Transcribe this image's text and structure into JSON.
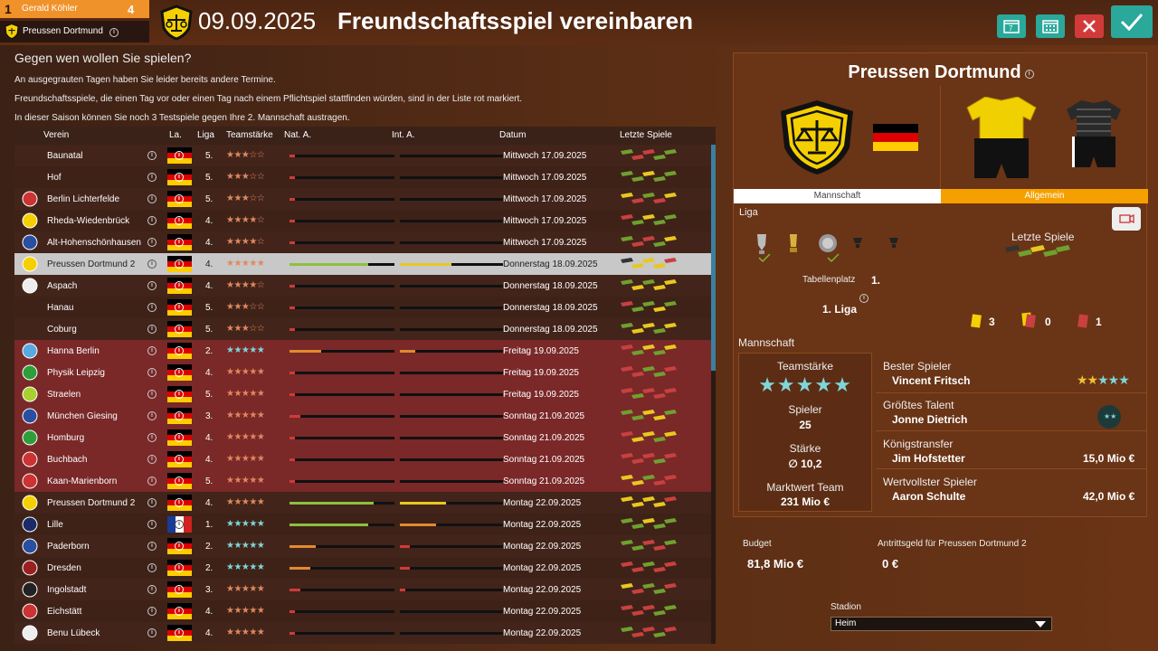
{
  "header": {
    "rank": "1",
    "manager": "Gerald Köhler",
    "manager_count": "4",
    "club": "Preussen Dortmund",
    "date": "09.09.2025",
    "title": "Freundschaftsspiel vereinbaren",
    "buttons": [
      {
        "name": "calendar-7-button",
        "icon": "calendar-7-icon",
        "color": "#2aa89a"
      },
      {
        "name": "calendar-button",
        "icon": "calendar-icon",
        "color": "#2aa89a"
      },
      {
        "name": "cancel-button",
        "icon": "close-icon",
        "color": "#d23a3a"
      },
      {
        "name": "confirm-button",
        "icon": "check-icon",
        "color": "#2aa89a"
      }
    ]
  },
  "main": {
    "question": "Gegen wen wollen Sie spielen?",
    "notes": [
      "An ausgegrauten Tagen haben Sie leider bereits andere Termine.",
      "Freundschaftsspiele, die einen Tag vor oder einen Tag nach einem Pflichtspiel stattfinden würden, sind in der Liste rot markiert.",
      "In dieser Saison können Sie noch 3 Testspiele gegen Ihre 2. Mannschaft austragen."
    ]
  },
  "columns": {
    "club": "Verein",
    "country": "La.",
    "league": "Liga",
    "strength": "Teamstärke",
    "nat": "Nat. A.",
    "intl": "Int. A.",
    "date": "Datum",
    "last": "Letzte Spiele"
  },
  "rows": [
    {
      "club": "Baunatal",
      "league": "5.",
      "stars": "★★★☆☆",
      "nat": 0.05,
      "intl": 0,
      "date": "Mittwoch 17.09.2025",
      "red": false,
      "sel": false,
      "flag": "de",
      "logo": "none",
      "last": [
        "g",
        "r",
        "r",
        "g",
        "g"
      ]
    },
    {
      "club": "Hof",
      "league": "5.",
      "stars": "★★★☆☆",
      "nat": 0.05,
      "intl": 0,
      "date": "Mittwoch 17.09.2025",
      "red": false,
      "sel": false,
      "flag": "de",
      "logo": "none",
      "last": [
        "g",
        "g",
        "y",
        "g",
        "g"
      ]
    },
    {
      "club": "Berlin Lichterfelde",
      "league": "5.",
      "stars": "★★★☆☆",
      "nat": 0.05,
      "intl": 0,
      "date": "Mittwoch 17.09.2025",
      "red": false,
      "sel": false,
      "flag": "de",
      "logo": "red",
      "last": [
        "y",
        "r",
        "g",
        "r",
        "y"
      ]
    },
    {
      "club": "Rheda-Wiedenbrück",
      "league": "4.",
      "stars": "★★★★☆",
      "nat": 0.05,
      "intl": 0,
      "date": "Mittwoch 17.09.2025",
      "red": false,
      "sel": false,
      "flag": "de",
      "logo": "yellow",
      "last": [
        "r",
        "g",
        "y",
        "g",
        "g"
      ]
    },
    {
      "club": "Alt-Hohenschönhausen",
      "league": "4.",
      "stars": "★★★★☆",
      "nat": 0.05,
      "intl": 0,
      "date": "Mittwoch 17.09.2025",
      "red": false,
      "sel": false,
      "flag": "de",
      "logo": "blue",
      "last": [
        "g",
        "r",
        "r",
        "g",
        "y"
      ]
    },
    {
      "club": "Preussen Dortmund 2",
      "league": "4.",
      "stars": "★★★★★",
      "nat": 0.75,
      "intl": 0.5,
      "date": "Donnerstag 18.09.2025",
      "red": false,
      "sel": true,
      "flag": "de",
      "logo": "yellow",
      "last": [
        "d",
        "y",
        "y",
        "y",
        "r"
      ]
    },
    {
      "club": "Aspach",
      "league": "4.",
      "stars": "★★★★☆",
      "nat": 0.05,
      "intl": 0,
      "date": "Donnerstag 18.09.2025",
      "red": false,
      "sel": false,
      "flag": "de",
      "logo": "white",
      "last": [
        "g",
        "y",
        "g",
        "y",
        "y"
      ]
    },
    {
      "club": "Hanau",
      "league": "5.",
      "stars": "★★★☆☆",
      "nat": 0.05,
      "intl": 0,
      "date": "Donnerstag 18.09.2025",
      "red": false,
      "sel": false,
      "flag": "de",
      "logo": "none",
      "last": [
        "r",
        "g",
        "g",
        "y",
        "g"
      ]
    },
    {
      "club": "Coburg",
      "league": "5.",
      "stars": "★★★☆☆",
      "nat": 0.05,
      "intl": 0,
      "date": "Donnerstag 18.09.2025",
      "red": false,
      "sel": false,
      "flag": "de",
      "logo": "none",
      "last": [
        "g",
        "y",
        "y",
        "g",
        "y"
      ]
    },
    {
      "club": "Hanna Berlin",
      "league": "2.",
      "stars": "★★★★★",
      "nat": 0.3,
      "intl": 0.15,
      "date": "Freitag 19.09.2025",
      "red": true,
      "sel": false,
      "flag": "de",
      "logo": "lightblue",
      "last": [
        "r",
        "g",
        "y",
        "g",
        "y"
      ],
      "teal": true
    },
    {
      "club": "Physik Leipzig",
      "league": "4.",
      "stars": "★★★★★",
      "nat": 0,
      "intl": 0,
      "date": "Freitag 19.09.2025",
      "red": true,
      "sel": false,
      "flag": "de",
      "logo": "green",
      "last": [
        "r",
        "r",
        "g",
        "g",
        "r"
      ]
    },
    {
      "club": "Straelen",
      "league": "5.",
      "stars": "★★★★★",
      "nat": 0,
      "intl": 0,
      "date": "Freitag 19.09.2025",
      "red": true,
      "sel": false,
      "flag": "de",
      "logo": "greenyellow",
      "last": [
        "r",
        "g",
        "r",
        "r",
        "r"
      ]
    },
    {
      "club": "München Giesing",
      "league": "3.",
      "stars": "★★★★★",
      "nat": 0.1,
      "intl": 0,
      "date": "Sonntag 21.09.2025",
      "red": true,
      "sel": false,
      "flag": "de",
      "logo": "blue",
      "last": [
        "g",
        "g",
        "y",
        "y",
        "g"
      ]
    },
    {
      "club": "Homburg",
      "league": "4.",
      "stars": "★★★★★",
      "nat": 0,
      "intl": 0,
      "date": "Sonntag 21.09.2025",
      "red": true,
      "sel": false,
      "flag": "de",
      "logo": "green",
      "last": [
        "r",
        "y",
        "y",
        "g",
        "y"
      ]
    },
    {
      "club": "Buchbach",
      "league": "4.",
      "stars": "★★★★★",
      "nat": 0,
      "intl": 0,
      "date": "Sonntag 21.09.2025",
      "red": true,
      "sel": false,
      "flag": "de",
      "logo": "red",
      "last": [
        "r",
        "r",
        "r",
        "g",
        "r"
      ]
    },
    {
      "club": "Kaan-Marienborn",
      "league": "5.",
      "stars": "★★★★★",
      "nat": 0,
      "intl": 0,
      "date": "Sonntag 21.09.2025",
      "red": true,
      "sel": false,
      "flag": "de",
      "logo": "red",
      "last": [
        "y",
        "y",
        "g",
        "r",
        "r"
      ]
    },
    {
      "club": "Preussen Dortmund 2",
      "league": "4.",
      "stars": "★★★★★",
      "nat": 0.8,
      "intl": 0.45,
      "date": "Montag 22.09.2025",
      "red": false,
      "sel": false,
      "flag": "de",
      "logo": "yellow",
      "last": [
        "y",
        "y",
        "y",
        "y",
        "r"
      ]
    },
    {
      "club": "Lille",
      "league": "1.",
      "stars": "★★★★★",
      "nat": 0.75,
      "intl": 0.35,
      "date": "Montag 22.09.2025",
      "red": false,
      "sel": false,
      "flag": "fr",
      "logo": "navy",
      "last": [
        "g",
        "g",
        "y",
        "g",
        "g"
      ],
      "teal": true
    },
    {
      "club": "Paderborn",
      "league": "2.",
      "stars": "★★★★★",
      "nat": 0.25,
      "intl": 0.1,
      "date": "Montag 22.09.2025",
      "red": false,
      "sel": false,
      "flag": "de",
      "logo": "blue",
      "last": [
        "g",
        "g",
        "r",
        "r",
        "g"
      ],
      "teal": true
    },
    {
      "club": "Dresden",
      "league": "2.",
      "stars": "★★★★★",
      "nat": 0.2,
      "intl": 0.1,
      "date": "Montag 22.09.2025",
      "red": false,
      "sel": false,
      "flag": "de",
      "logo": "darkred",
      "last": [
        "r",
        "r",
        "g",
        "r",
        "r"
      ],
      "teal": true
    },
    {
      "club": "Ingolstadt",
      "league": "3.",
      "stars": "★★★★★",
      "nat": 0.1,
      "intl": 0.05,
      "date": "Montag 22.09.2025",
      "red": false,
      "sel": false,
      "flag": "de",
      "logo": "black",
      "last": [
        "y",
        "r",
        "g",
        "g",
        "r"
      ]
    },
    {
      "club": "Eichstätt",
      "league": "4.",
      "stars": "★★★★★",
      "nat": 0.05,
      "intl": 0,
      "date": "Montag 22.09.2025",
      "red": false,
      "sel": false,
      "flag": "de",
      "logo": "red",
      "last": [
        "r",
        "r",
        "r",
        "g",
        "g"
      ]
    },
    {
      "club": "Benu Lübeck",
      "league": "4.",
      "stars": "★★★★★",
      "nat": 0.05,
      "intl": 0,
      "date": "Montag 22.09.2025",
      "red": false,
      "sel": false,
      "flag": "de",
      "logo": "white",
      "last": [
        "g",
        "r",
        "r",
        "g",
        "r"
      ]
    }
  ],
  "panel": {
    "club": "Preussen Dortmund",
    "tabs": [
      "Mannschaft",
      "Allgemein"
    ],
    "liga_label": "Liga",
    "table_label": "Tabellenplatz",
    "table_value": "1.",
    "league_name": "1. Liga",
    "last_label": "Letzte Spiele",
    "yellow_cards": "3",
    "yellowred_cards": "0",
    "red_cards": "1",
    "team_label": "Mannschaft",
    "strength_label": "Teamstärke",
    "players_label": "Spieler",
    "players_value": "25",
    "power_label": "Stärke",
    "power_value": "∅ 10,2",
    "value_label": "Marktwert Team",
    "value_value": "231 Mio €",
    "best_label": "Bester Spieler",
    "best_name": "Vincent Fritsch",
    "talent_label": "Größtes Talent",
    "talent_name": "Jonne Dietrich",
    "transfer_label": "Königstransfer",
    "transfer_name": "Jim Hofstetter",
    "transfer_value": "15,0 Mio €",
    "valuable_label": "Wertvollster Spieler",
    "valuable_name": "Aaron Schulte",
    "valuable_value": "42,0 Mio €",
    "budget_label": "Budget",
    "budget_value": "81,8 Mio €",
    "fee_label": "Antrittsgeld für Preussen Dortmund 2",
    "fee_value": "0 €",
    "stadium_label": "Stadion",
    "stadium_value": "Heim"
  }
}
